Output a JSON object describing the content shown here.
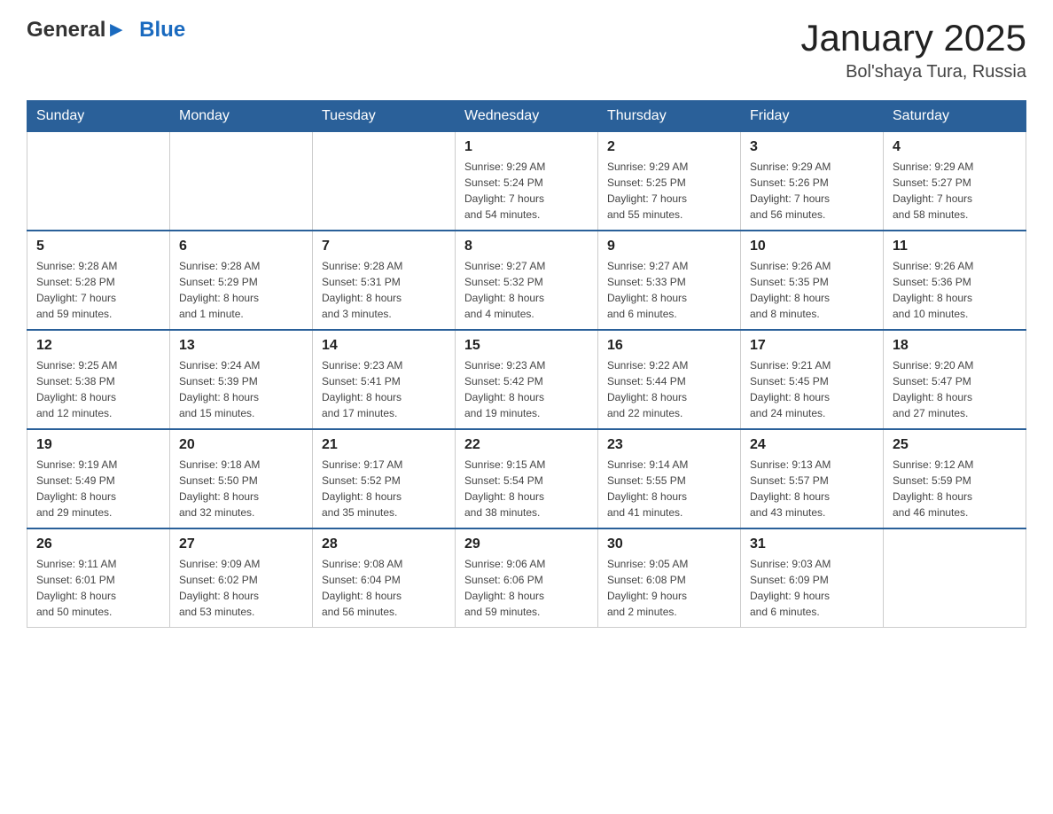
{
  "header": {
    "logo": {
      "text_general": "General",
      "text_blue": "Blue"
    },
    "title": "January 2025",
    "subtitle": "Bol'shaya Tura, Russia"
  },
  "days_of_week": [
    "Sunday",
    "Monday",
    "Tuesday",
    "Wednesday",
    "Thursday",
    "Friday",
    "Saturday"
  ],
  "weeks": [
    [
      {
        "day": "",
        "info": ""
      },
      {
        "day": "",
        "info": ""
      },
      {
        "day": "",
        "info": ""
      },
      {
        "day": "1",
        "info": "Sunrise: 9:29 AM\nSunset: 5:24 PM\nDaylight: 7 hours\nand 54 minutes."
      },
      {
        "day": "2",
        "info": "Sunrise: 9:29 AM\nSunset: 5:25 PM\nDaylight: 7 hours\nand 55 minutes."
      },
      {
        "day": "3",
        "info": "Sunrise: 9:29 AM\nSunset: 5:26 PM\nDaylight: 7 hours\nand 56 minutes."
      },
      {
        "day": "4",
        "info": "Sunrise: 9:29 AM\nSunset: 5:27 PM\nDaylight: 7 hours\nand 58 minutes."
      }
    ],
    [
      {
        "day": "5",
        "info": "Sunrise: 9:28 AM\nSunset: 5:28 PM\nDaylight: 7 hours\nand 59 minutes."
      },
      {
        "day": "6",
        "info": "Sunrise: 9:28 AM\nSunset: 5:29 PM\nDaylight: 8 hours\nand 1 minute."
      },
      {
        "day": "7",
        "info": "Sunrise: 9:28 AM\nSunset: 5:31 PM\nDaylight: 8 hours\nand 3 minutes."
      },
      {
        "day": "8",
        "info": "Sunrise: 9:27 AM\nSunset: 5:32 PM\nDaylight: 8 hours\nand 4 minutes."
      },
      {
        "day": "9",
        "info": "Sunrise: 9:27 AM\nSunset: 5:33 PM\nDaylight: 8 hours\nand 6 minutes."
      },
      {
        "day": "10",
        "info": "Sunrise: 9:26 AM\nSunset: 5:35 PM\nDaylight: 8 hours\nand 8 minutes."
      },
      {
        "day": "11",
        "info": "Sunrise: 9:26 AM\nSunset: 5:36 PM\nDaylight: 8 hours\nand 10 minutes."
      }
    ],
    [
      {
        "day": "12",
        "info": "Sunrise: 9:25 AM\nSunset: 5:38 PM\nDaylight: 8 hours\nand 12 minutes."
      },
      {
        "day": "13",
        "info": "Sunrise: 9:24 AM\nSunset: 5:39 PM\nDaylight: 8 hours\nand 15 minutes."
      },
      {
        "day": "14",
        "info": "Sunrise: 9:23 AM\nSunset: 5:41 PM\nDaylight: 8 hours\nand 17 minutes."
      },
      {
        "day": "15",
        "info": "Sunrise: 9:23 AM\nSunset: 5:42 PM\nDaylight: 8 hours\nand 19 minutes."
      },
      {
        "day": "16",
        "info": "Sunrise: 9:22 AM\nSunset: 5:44 PM\nDaylight: 8 hours\nand 22 minutes."
      },
      {
        "day": "17",
        "info": "Sunrise: 9:21 AM\nSunset: 5:45 PM\nDaylight: 8 hours\nand 24 minutes."
      },
      {
        "day": "18",
        "info": "Sunrise: 9:20 AM\nSunset: 5:47 PM\nDaylight: 8 hours\nand 27 minutes."
      }
    ],
    [
      {
        "day": "19",
        "info": "Sunrise: 9:19 AM\nSunset: 5:49 PM\nDaylight: 8 hours\nand 29 minutes."
      },
      {
        "day": "20",
        "info": "Sunrise: 9:18 AM\nSunset: 5:50 PM\nDaylight: 8 hours\nand 32 minutes."
      },
      {
        "day": "21",
        "info": "Sunrise: 9:17 AM\nSunset: 5:52 PM\nDaylight: 8 hours\nand 35 minutes."
      },
      {
        "day": "22",
        "info": "Sunrise: 9:15 AM\nSunset: 5:54 PM\nDaylight: 8 hours\nand 38 minutes."
      },
      {
        "day": "23",
        "info": "Sunrise: 9:14 AM\nSunset: 5:55 PM\nDaylight: 8 hours\nand 41 minutes."
      },
      {
        "day": "24",
        "info": "Sunrise: 9:13 AM\nSunset: 5:57 PM\nDaylight: 8 hours\nand 43 minutes."
      },
      {
        "day": "25",
        "info": "Sunrise: 9:12 AM\nSunset: 5:59 PM\nDaylight: 8 hours\nand 46 minutes."
      }
    ],
    [
      {
        "day": "26",
        "info": "Sunrise: 9:11 AM\nSunset: 6:01 PM\nDaylight: 8 hours\nand 50 minutes."
      },
      {
        "day": "27",
        "info": "Sunrise: 9:09 AM\nSunset: 6:02 PM\nDaylight: 8 hours\nand 53 minutes."
      },
      {
        "day": "28",
        "info": "Sunrise: 9:08 AM\nSunset: 6:04 PM\nDaylight: 8 hours\nand 56 minutes."
      },
      {
        "day": "29",
        "info": "Sunrise: 9:06 AM\nSunset: 6:06 PM\nDaylight: 8 hours\nand 59 minutes."
      },
      {
        "day": "30",
        "info": "Sunrise: 9:05 AM\nSunset: 6:08 PM\nDaylight: 9 hours\nand 2 minutes."
      },
      {
        "day": "31",
        "info": "Sunrise: 9:03 AM\nSunset: 6:09 PM\nDaylight: 9 hours\nand 6 minutes."
      },
      {
        "day": "",
        "info": ""
      }
    ]
  ]
}
